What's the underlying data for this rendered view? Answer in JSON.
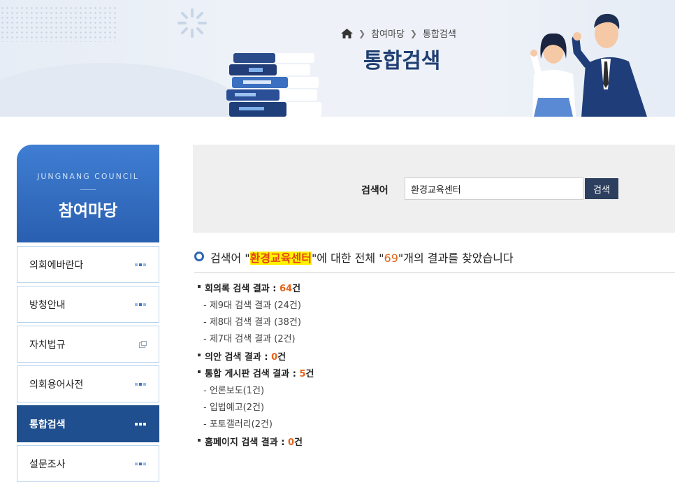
{
  "header": {
    "breadcrumb": [
      "참여마당",
      "통합검색"
    ],
    "title": "통합검색"
  },
  "sidebar": {
    "english": "JUNGNANG COUNCIL",
    "heading": "참여마당",
    "items": [
      {
        "label": "의회에바란다",
        "icon": "dots-icon"
      },
      {
        "label": "방청안내",
        "icon": "dots-icon"
      },
      {
        "label": "자치법규",
        "icon": "external-link-icon"
      },
      {
        "label": "의회용어사전",
        "icon": "dots-icon"
      },
      {
        "label": "통합검색",
        "icon": "dots-icon",
        "active": true
      },
      {
        "label": "설문조사",
        "icon": "dots-icon"
      }
    ]
  },
  "search": {
    "label": "검색어",
    "value": "환경교육센터",
    "button": "검색"
  },
  "summary": {
    "prefix": "검색어 \"",
    "keyword": "환경교육센터",
    "middle": "\"에 대한 전체 \"",
    "total": "69",
    "suffix": "\"개의 결과를 찾았습니다"
  },
  "results": [
    {
      "label": "회의록 검색 결과 : ",
      "count": "64",
      "unit": "건",
      "subs": [
        "- 제9대 검색 결과 (24건)",
        "- 제8대 검색 결과 (38건)",
        "- 제7대 검색 결과 (2건)"
      ]
    },
    {
      "label": "의안 검색 결과 : ",
      "count": "0",
      "unit": "건",
      "subs": []
    },
    {
      "label": "통합 게시판 검색 결과 : ",
      "count": "5",
      "unit": "건",
      "subs": [
        "- 언론보도(1건)",
        "- 입법예고(2건)",
        "- 포토갤러리(2건)"
      ]
    },
    {
      "label": "홈페이지 검색 결과 : ",
      "count": "0",
      "unit": "건",
      "subs": []
    }
  ],
  "colors": {
    "accent": "#2f66b5",
    "nav_active": "#1f4f8e",
    "highlight_bg": "#fff200",
    "count": "#e4641a"
  }
}
